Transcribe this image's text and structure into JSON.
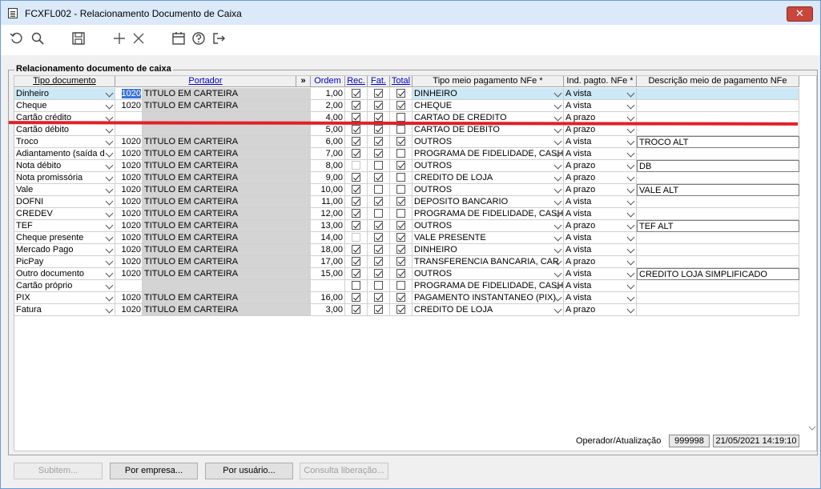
{
  "window": {
    "title": "FCXFL002 - Relacionamento Documento de Caixa",
    "close": "✕"
  },
  "panel": {
    "title": "Relacionamento documento de caixa"
  },
  "headers": {
    "tipo": "Tipo documento",
    "portador": "Portador",
    "more": "»",
    "ordem": "Ordem",
    "rec": "Rec.",
    "fat": "Fat.",
    "total": "Total",
    "tipo_meio": "Tipo meio pagamento NFe *",
    "ind": "Ind. pagto. NFe *",
    "desc": "Descrição meio de pagamento NFe"
  },
  "rows": [
    {
      "tipo": "Dinheiro",
      "cod": "1020",
      "port": "TITULO EM CARTEIRA",
      "ordem": "1,00",
      "rec": true,
      "fat": true,
      "total": true,
      "meio": "DINHEIRO",
      "ind": "A vista",
      "desc": "",
      "selected": true
    },
    {
      "tipo": "Cheque",
      "cod": "1020",
      "port": "TITULO EM CARTEIRA",
      "ordem": "2,00",
      "rec": true,
      "fat": true,
      "total": true,
      "meio": "CHEQUE",
      "ind": "A vista",
      "desc": ""
    },
    {
      "tipo": "Cartão crédito",
      "cod": "",
      "port": "",
      "ordem": "4,00",
      "rec": true,
      "fat": true,
      "total": false,
      "meio": "CARTAO DE CREDITO",
      "ind": "A prazo",
      "desc": "",
      "nocod": true
    },
    {
      "tipo": "Cartão débito",
      "cod": "",
      "port": "",
      "ordem": "5,00",
      "rec": true,
      "fat": true,
      "total": false,
      "meio": "CARTAO DE DEBITO",
      "ind": "A prazo",
      "desc": "",
      "nocod": true
    },
    {
      "tipo": "Troco",
      "cod": "1020",
      "port": "TITULO EM CARTEIRA",
      "ordem": "6,00",
      "rec": true,
      "fat": true,
      "total": true,
      "meio": "OUTROS",
      "ind": "A vista",
      "desc": "TROCO ALT"
    },
    {
      "tipo": "Adiantamento (saída d",
      "cod": "1020",
      "port": "TITULO EM CARTEIRA",
      "ordem": "7,00",
      "rec": true,
      "fat": true,
      "total": false,
      "meio": "PROGRAMA DE FIDELIDADE, CASH",
      "ind": "A vista",
      "desc": ""
    },
    {
      "tipo": "Nota débito",
      "cod": "1020",
      "port": "TITULO EM CARTEIRA",
      "ordem": "8,00",
      "rec": false,
      "fat": false,
      "total": true,
      "meio": "OUTROS",
      "ind": "A prazo",
      "desc": "DB",
      "recdim": true
    },
    {
      "tipo": "Nota promissória",
      "cod": "1020",
      "port": "TITULO EM CARTEIRA",
      "ordem": "9,00",
      "rec": true,
      "fat": true,
      "total": false,
      "meio": "CREDITO DE LOJA",
      "ind": "A prazo",
      "desc": ""
    },
    {
      "tipo": "Vale",
      "cod": "1020",
      "port": "TITULO EM CARTEIRA",
      "ordem": "10,00",
      "rec": true,
      "fat": false,
      "total": false,
      "meio": "OUTROS",
      "ind": "A prazo",
      "desc": "VALE ALT"
    },
    {
      "tipo": "DOFNI",
      "cod": "1020",
      "port": "TITULO EM CARTEIRA",
      "ordem": "11,00",
      "rec": true,
      "fat": true,
      "total": true,
      "meio": "DEPOSITO BANCARIO",
      "ind": "A vista",
      "desc": ""
    },
    {
      "tipo": "CREDEV",
      "cod": "1020",
      "port": "TITULO EM CARTEIRA",
      "ordem": "12,00",
      "rec": true,
      "fat": false,
      "total": false,
      "meio": "PROGRAMA DE FIDELIDADE, CASH",
      "ind": "A vista",
      "desc": ""
    },
    {
      "tipo": "TEF",
      "cod": "1020",
      "port": "TITULO EM CARTEIRA",
      "ordem": "13,00",
      "rec": true,
      "fat": true,
      "total": true,
      "meio": "OUTROS",
      "ind": "A prazo",
      "desc": "TEF ALT"
    },
    {
      "tipo": "Cheque presente",
      "cod": "1020",
      "port": "TITULO EM CARTEIRA",
      "ordem": "14,00",
      "rec": false,
      "fat": true,
      "total": true,
      "meio": "VALE PRESENTE",
      "ind": "A vista",
      "desc": "",
      "recdim": true
    },
    {
      "tipo": "Mercado Pago",
      "cod": "1020",
      "port": "TITULO EM CARTEIRA",
      "ordem": "18,00",
      "rec": true,
      "fat": true,
      "total": true,
      "meio": "DINHEIRO",
      "ind": "A vista",
      "desc": ""
    },
    {
      "tipo": "PicPay",
      "cod": "1020",
      "port": "TITULO EM CARTEIRA",
      "ordem": "17,00",
      "rec": true,
      "fat": true,
      "total": true,
      "meio": "TRANSFERENCIA BANCARIA, CAR",
      "ind": "A prazo",
      "desc": ""
    },
    {
      "tipo": "Outro documento",
      "cod": "1020",
      "port": "TITULO EM CARTEIRA",
      "ordem": "15,00",
      "rec": true,
      "fat": true,
      "total": true,
      "meio": "OUTROS",
      "ind": "A vista",
      "desc": "CREDITO LOJA SIMPLIFICADO"
    },
    {
      "tipo": "Cartão próprio",
      "cod": "",
      "port": "",
      "ordem": "",
      "rec": false,
      "fat": false,
      "total": false,
      "meio": "PROGRAMA DE FIDELIDADE, CASH",
      "ind": "A vista",
      "desc": "",
      "nocod": true
    },
    {
      "tipo": "PIX",
      "cod": "1020",
      "port": "TITULO EM CARTEIRA",
      "ordem": "16,00",
      "rec": true,
      "fat": true,
      "total": true,
      "meio": "PAGAMENTO INSTANTANEO (PIX)",
      "ind": "A vista",
      "desc": ""
    },
    {
      "tipo": "Fatura",
      "cod": "1020",
      "port": "TITULO EM CARTEIRA",
      "ordem": "3,00",
      "rec": true,
      "fat": true,
      "total": true,
      "meio": "CREDITO DE LOJA",
      "ind": "A prazo",
      "desc": ""
    }
  ],
  "footer": {
    "label": "Operador/Atualização",
    "operador": "999998",
    "data": "21/05/2021 14:19:10"
  },
  "buttons": {
    "subitem": "Subitem...",
    "empresa": "Por empresa...",
    "usuario": "Por usuário...",
    "consulta": "Consulta liberação..."
  },
  "icons": [
    "refresh-icon",
    "search-icon",
    "save-icon",
    "add-icon",
    "delete-icon",
    "calendar-icon",
    "help-icon",
    "exit-icon"
  ],
  "colors": {
    "selected_row": "#cde8f6",
    "highlight_line": "#e0202a",
    "header_link": "#0000c0"
  }
}
